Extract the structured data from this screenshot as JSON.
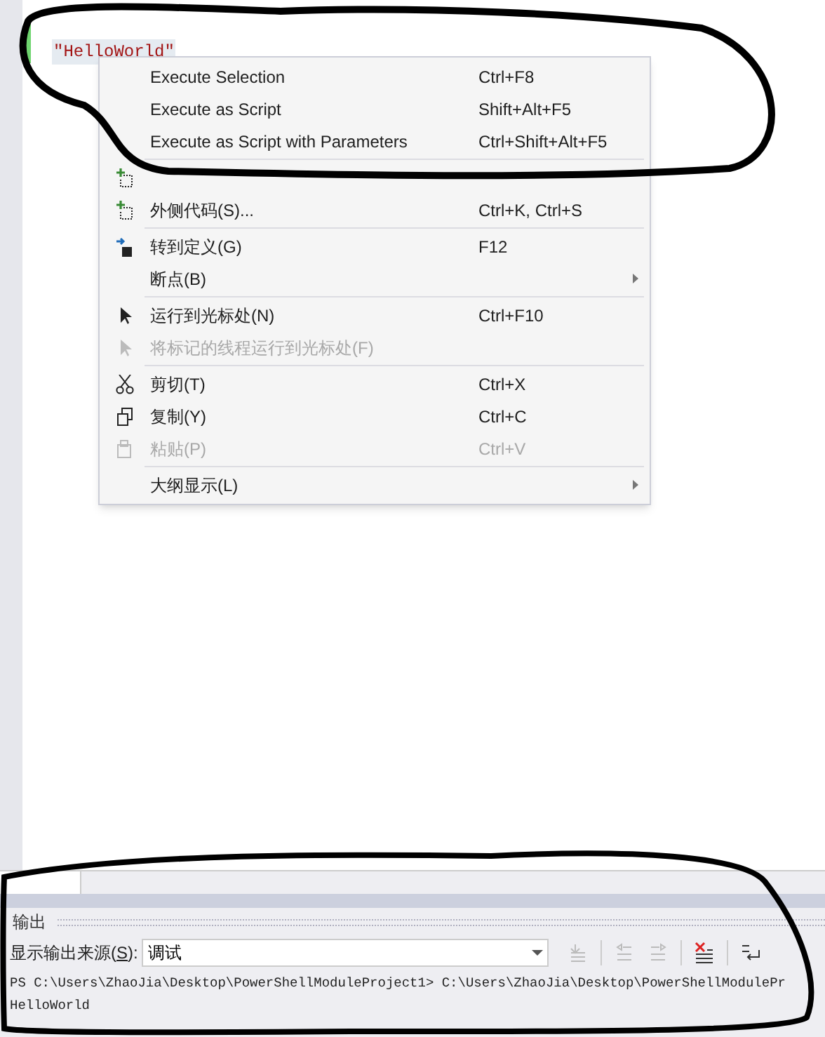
{
  "editor": {
    "code_line": "\"HelloWorld\""
  },
  "context_menu": {
    "groups": [
      [
        {
          "label": "Execute Selection",
          "shortcut": "Ctrl+F8",
          "kind": "plain",
          "disabled": false,
          "submenu": false
        },
        {
          "label": "Execute as Script",
          "shortcut": "Shift+Alt+F5",
          "kind": "plain",
          "disabled": false,
          "submenu": false
        },
        {
          "label": "Execute as Script with Parameters",
          "shortcut": "Ctrl+Shift+Alt+F5",
          "kind": "plain",
          "disabled": false,
          "submenu": false
        }
      ],
      [
        {
          "kind": "snippet",
          "disabled": false,
          "submenu": false
        },
        {
          "label": "外侧代码(S)...",
          "shortcut": "Ctrl+K, Ctrl+S",
          "kind": "snippet",
          "disabled": false,
          "submenu": false
        }
      ],
      [
        {
          "label": "转到定义(G)",
          "shortcut": "F12",
          "kind": "goto",
          "disabled": false,
          "submenu": false
        },
        {
          "label": "断点(B)",
          "kind": "plain",
          "disabled": false,
          "submenu": true
        }
      ],
      [
        {
          "label": "运行到光标处(N)",
          "shortcut": "Ctrl+F10",
          "kind": "cursor",
          "disabled": false,
          "submenu": false
        },
        {
          "label": "将标记的线程运行到光标处(F)",
          "kind": "cursor",
          "disabled": true,
          "submenu": false
        }
      ],
      [
        {
          "label": "剪切(T)",
          "shortcut": "Ctrl+X",
          "kind": "cut",
          "disabled": false,
          "submenu": false
        },
        {
          "label": "复制(Y)",
          "shortcut": "Ctrl+C",
          "kind": "copy",
          "disabled": false,
          "submenu": false
        },
        {
          "label": "粘贴(P)",
          "shortcut": "Ctrl+V",
          "kind": "paste",
          "disabled": true,
          "submenu": false
        }
      ],
      [
        {
          "label": "大纲显示(L)",
          "kind": "plain",
          "disabled": false,
          "submenu": true
        }
      ]
    ]
  },
  "output_panel": {
    "title": "输出",
    "source_label": "显示输出来源(**S**):",
    "source_value": "调试",
    "lines": [
      "PS C:\\Users\\ZhaoJia\\Desktop\\PowerShellModuleProject1> C:\\Users\\ZhaoJia\\Desktop\\PowerShellModulePr",
      "HelloWorld"
    ]
  }
}
